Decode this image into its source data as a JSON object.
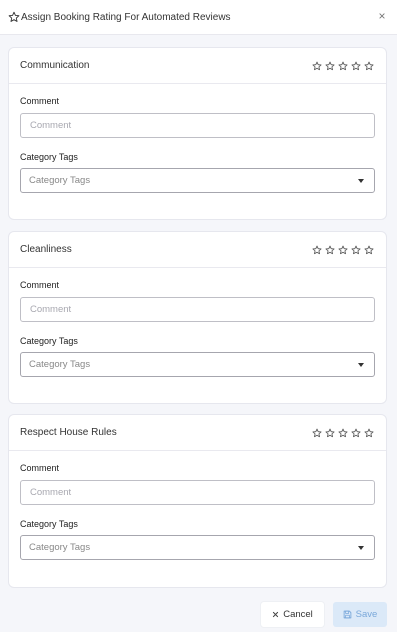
{
  "dialog": {
    "title": "Assign Booking Rating For Automated Reviews",
    "close_symbol": "×"
  },
  "cards": [
    {
      "title": "Communication",
      "rating": 0,
      "max_rating": 5,
      "comment_label": "Comment",
      "comment_placeholder": "Comment",
      "comment_value": "",
      "tags_label": "Category Tags",
      "tags_placeholder": "Category Tags"
    },
    {
      "title": "Cleanliness",
      "rating": 0,
      "max_rating": 5,
      "comment_label": "Comment",
      "comment_placeholder": "Comment",
      "comment_value": "",
      "tags_label": "Category Tags",
      "tags_placeholder": "Category Tags"
    },
    {
      "title": "Respect House Rules",
      "rating": 0,
      "max_rating": 5,
      "comment_label": "Comment",
      "comment_placeholder": "Comment",
      "comment_value": "",
      "tags_label": "Category Tags",
      "tags_placeholder": "Category Tags"
    }
  ],
  "footer": {
    "cancel_label": "Cancel",
    "cancel_icon": "close-icon",
    "save_label": "Save",
    "save_icon": "save-icon"
  },
  "colors": {
    "background": "#f5f6fa",
    "save_bg": "#dbe9f8",
    "save_text": "#7aa8da",
    "star_outline": "#555555"
  }
}
